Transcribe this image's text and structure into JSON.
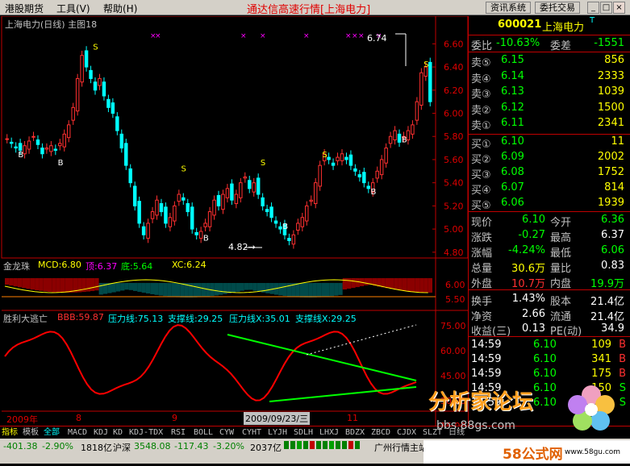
{
  "menu": {
    "items": [
      "港股期货",
      "工具(V)",
      "帮助(H)"
    ]
  },
  "app_title": "通达信高速行情[上海电力]",
  "buttons": {
    "news": "资讯系统",
    "trade": "委托交易"
  },
  "window_controls": {
    "min": "_",
    "max": "□",
    "close": "×"
  },
  "chart": {
    "title": "上海电力(日线) 主图18",
    "price_axis": [
      "6.60",
      "6.40",
      "6.20",
      "6.00",
      "5.80",
      "5.60",
      "5.40",
      "5.20",
      "5.00",
      "4.80"
    ],
    "high_marker": "6.74",
    "low_marker": "4.82→",
    "signal_b": "B",
    "signal_s": "S",
    "x_markers": "×",
    "indicator1": {
      "name": "金龙珠",
      "mcd": "MCD:6.80",
      "top": "顶:6.37",
      "bottom": "底:5.64",
      "xc": "XC:6.24",
      "axis": [
        "6.00",
        "5.50"
      ]
    },
    "indicator2": {
      "name": "胜利大逃亡",
      "bbb": "BBB:59.87",
      "resistance": "压力线:75.13",
      "support": "支撑线:29.25",
      "resistance_x": "压力线X:35.01",
      "support_x": "支撑线X:29.25",
      "axis": [
        "75.00",
        "60.00",
        "45.00",
        "30.00",
        "15.00"
      ]
    },
    "date_labels": [
      "2009年",
      "8",
      "9",
      "2009/09/23/三",
      "11"
    ]
  },
  "quote": {
    "code": "600021",
    "name": "上海电力",
    "badge": "T",
    "weibi_label": "委比",
    "weibi_value": "-10.63%",
    "weicha_label": "委差",
    "weicha_value": "-1551",
    "sells": [
      {
        "label": "卖⑤",
        "price": "6.15",
        "vol": "856"
      },
      {
        "label": "卖④",
        "price": "6.14",
        "vol": "2333"
      },
      {
        "label": "卖③",
        "price": "6.13",
        "vol": "1039"
      },
      {
        "label": "卖②",
        "price": "6.12",
        "vol": "1500"
      },
      {
        "label": "卖①",
        "price": "6.11",
        "vol": "2341"
      }
    ],
    "buys": [
      {
        "label": "买①",
        "price": "6.10",
        "vol": "11"
      },
      {
        "label": "买②",
        "price": "6.09",
        "vol": "2002"
      },
      {
        "label": "买③",
        "price": "6.08",
        "vol": "1752"
      },
      {
        "label": "买④",
        "price": "6.07",
        "vol": "814"
      },
      {
        "label": "买⑤",
        "price": "6.06",
        "vol": "1939"
      }
    ],
    "stats": [
      {
        "l1": "现价",
        "v1": "6.10",
        "l2": "今开",
        "v2": "6.36"
      },
      {
        "l1": "涨跌",
        "v1": "-0.27",
        "l2": "最高",
        "v2": "6.37"
      },
      {
        "l1": "涨幅",
        "v1": "-4.24%",
        "l2": "最低",
        "v2": "6.06"
      },
      {
        "l1": "总量",
        "v1": "30.6万",
        "l2": "量比",
        "v2": "0.83"
      },
      {
        "l1": "外盘",
        "v1": "10.7万",
        "l2": "内盘",
        "v2": "19.9万"
      }
    ],
    "finance": [
      {
        "l1": "换手",
        "v1": "1.43%",
        "l2": "股本",
        "v2": "21.4亿"
      },
      {
        "l1": "净资",
        "v1": "2.66",
        "l2": "流通",
        "v2": "21.4亿"
      },
      {
        "l1": "收益(三)",
        "v1": "0.13",
        "l2": "PE(动)",
        "v2": "34.9"
      }
    ],
    "ticks": [
      {
        "time": "14:59",
        "price": "6.10",
        "vol": "109",
        "side": "B"
      },
      {
        "time": "14:59",
        "price": "6.10",
        "vol": "341",
        "side": "B"
      },
      {
        "time": "14:59",
        "price": "6.10",
        "vol": "175",
        "side": "B"
      },
      {
        "time": "14:59",
        "price": "6.10",
        "vol": "150",
        "side": "S"
      },
      {
        "time": "14:59",
        "price": "6.10",
        "vol": "20",
        "side": "S"
      }
    ]
  },
  "tabs": [
    "指标",
    "模板",
    "全部",
    "MACD",
    "KDJ",
    "KD",
    "KDJ-TDX",
    "RSI",
    "BOLL",
    "CYW",
    "CYHT",
    "LYJH",
    "SDLH",
    "LHXJ",
    "BDZX",
    "ZBCD",
    "CJDX",
    "SLZT",
    "日线"
  ],
  "status": {
    "sh_change": "-401.38",
    "sh_pct": "-2.90%",
    "sh_amount": "1818亿",
    "sz_name": "沪深",
    "sz_index": "3548.08",
    "sz_change": "-117.43",
    "sz_pct": "-3.20%",
    "sz_amount": "2037亿",
    "server": "广州行情主站"
  },
  "watermark": {
    "title": "分析家论坛",
    "url": "bbs.88gs.com",
    "brand": "58公式网",
    "site": "www.58gu.com"
  },
  "colors": {
    "up": "#ff3030",
    "down": "#00ffff",
    "accent": "#ffff00",
    "panel_border": "#c00000"
  }
}
